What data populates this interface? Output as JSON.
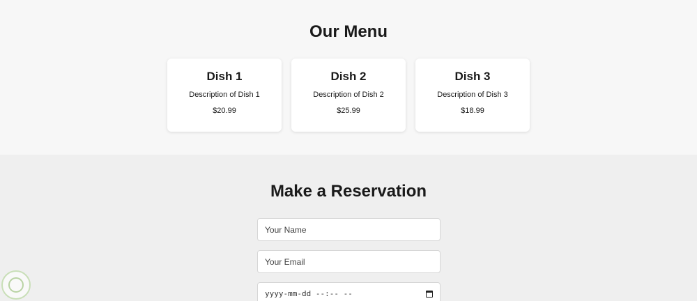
{
  "menu": {
    "title": "Our Menu",
    "dishes": [
      {
        "name": "Dish 1",
        "description": "Description of Dish 1",
        "price": "$20.99"
      },
      {
        "name": "Dish 2",
        "description": "Description of Dish 2",
        "price": "$25.99"
      },
      {
        "name": "Dish 3",
        "description": "Description of Dish 3",
        "price": "$18.99"
      }
    ]
  },
  "reservation": {
    "title": "Make a Reservation",
    "name_placeholder": "Your Name",
    "email_placeholder": "Your Email",
    "datetime_placeholder": "yyyy-mm-dd --:-- --",
    "calendar_icon": "calendar-icon"
  },
  "watermark": {
    "icon": "watermark-badge-icon",
    "colors": {
      "ring": "#c9dfb8"
    }
  }
}
